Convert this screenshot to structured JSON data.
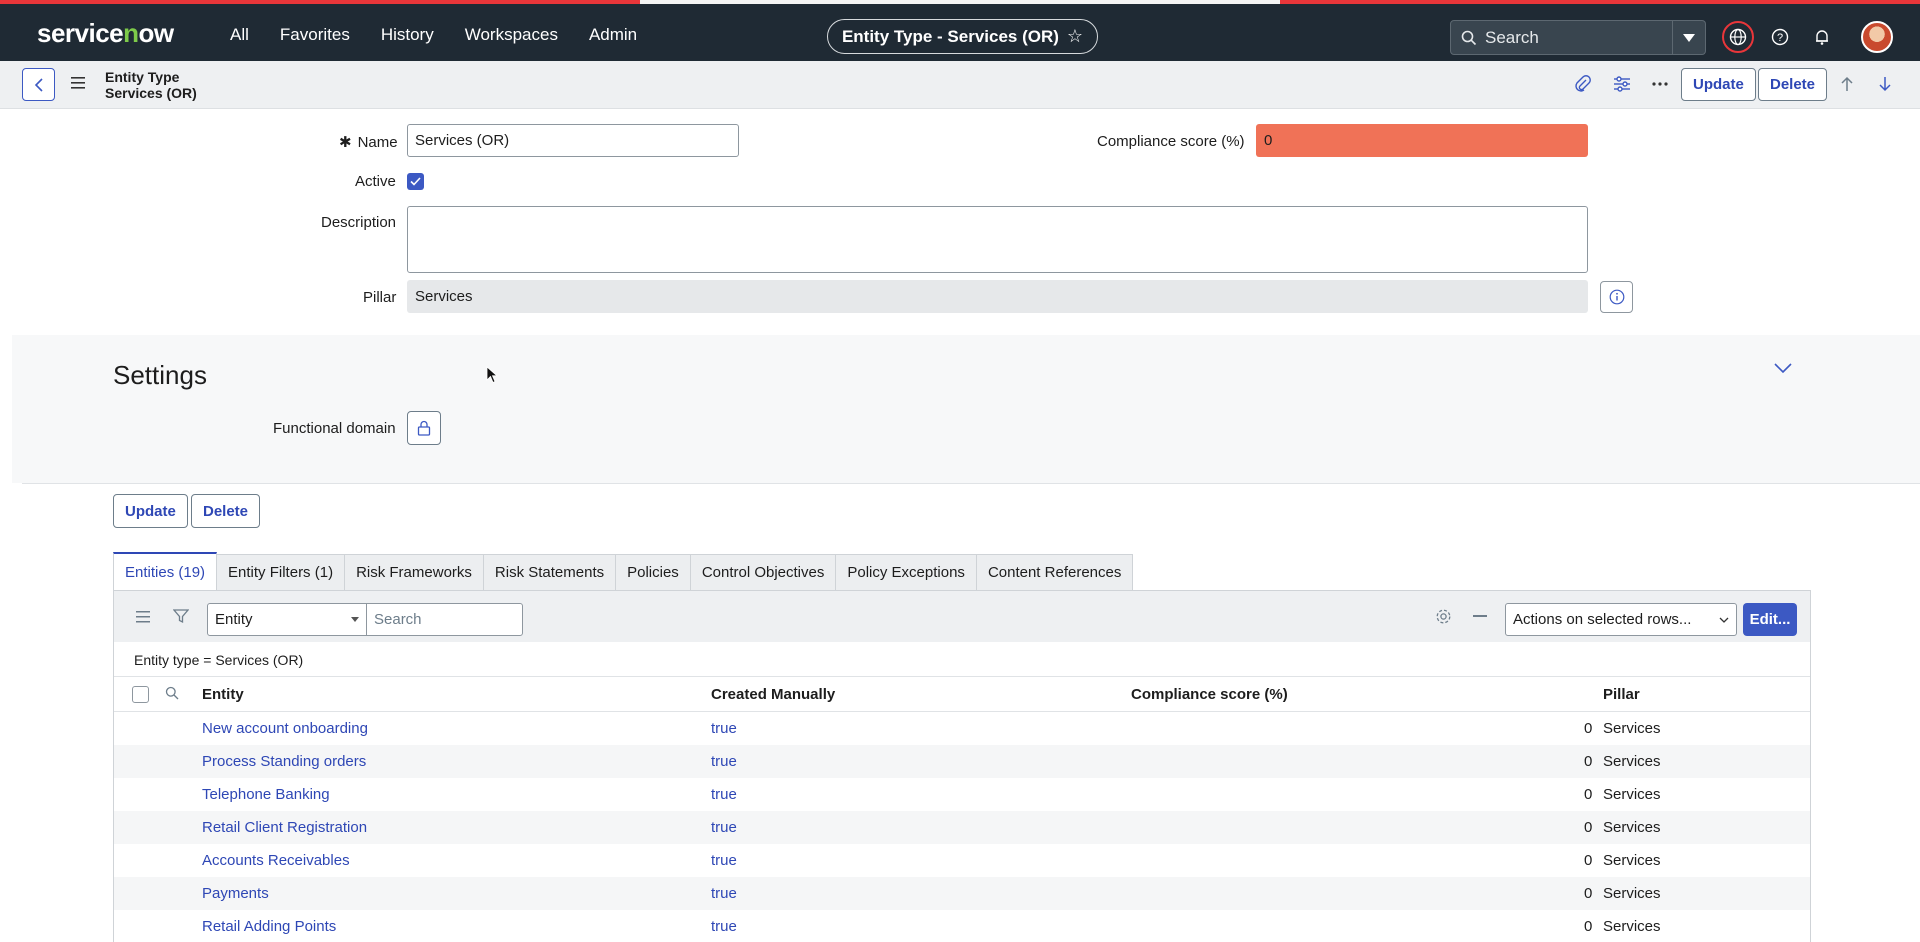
{
  "nav": {
    "logo": "servicenow",
    "links": [
      "All",
      "Favorites",
      "History",
      "Workspaces",
      "Admin"
    ],
    "context_title": "Entity Type - Services (OR)",
    "search_placeholder": "Search"
  },
  "header": {
    "title_line1": "Entity Type",
    "title_line2": "Services (OR)",
    "update_label": "Update",
    "delete_label": "Delete"
  },
  "form": {
    "name_label": "Name",
    "name_value": "Services (OR)",
    "compliance_label": "Compliance score (%)",
    "compliance_value": "0",
    "active_label": "Active",
    "description_label": "Description",
    "description_value": "",
    "pillar_label": "Pillar",
    "pillar_value": "Services"
  },
  "settings": {
    "title": "Settings",
    "functional_domain_label": "Functional domain"
  },
  "bottom_buttons": {
    "update_label": "Update",
    "delete_label": "Delete"
  },
  "related_tabs": [
    "Entities (19)",
    "Entity Filters (1)",
    "Risk Frameworks",
    "Risk Statements",
    "Policies",
    "Control Objectives",
    "Policy Exceptions",
    "Content References"
  ],
  "list": {
    "field_select": "Entity",
    "search_placeholder": "Search",
    "actions_select": "Actions on selected rows...",
    "edit_label": "Edit...",
    "breadcrumb": "Entity type = Services (OR)",
    "columns": [
      "Entity",
      "Created Manually",
      "Compliance score (%)",
      "Pillar"
    ],
    "rows": [
      {
        "entity": "New account onboarding",
        "created": "true",
        "score": "0",
        "pillar": "Services"
      },
      {
        "entity": "Process Standing orders",
        "created": "true",
        "score": "0",
        "pillar": "Services"
      },
      {
        "entity": "Telephone Banking",
        "created": "true",
        "score": "0",
        "pillar": "Services"
      },
      {
        "entity": "Retail Client Registration",
        "created": "true",
        "score": "0",
        "pillar": "Services"
      },
      {
        "entity": "Accounts Receivables",
        "created": "true",
        "score": "0",
        "pillar": "Services"
      },
      {
        "entity": "Payments",
        "created": "true",
        "score": "0",
        "pillar": "Services"
      },
      {
        "entity": "Retail Adding Points",
        "created": "true",
        "score": "0",
        "pillar": "Services"
      }
    ]
  },
  "colors": {
    "nav_bg": "#1f2a34",
    "accent": "#3c59c3",
    "compliance_bad": "#f07257",
    "brand_red": "#e9363a"
  }
}
